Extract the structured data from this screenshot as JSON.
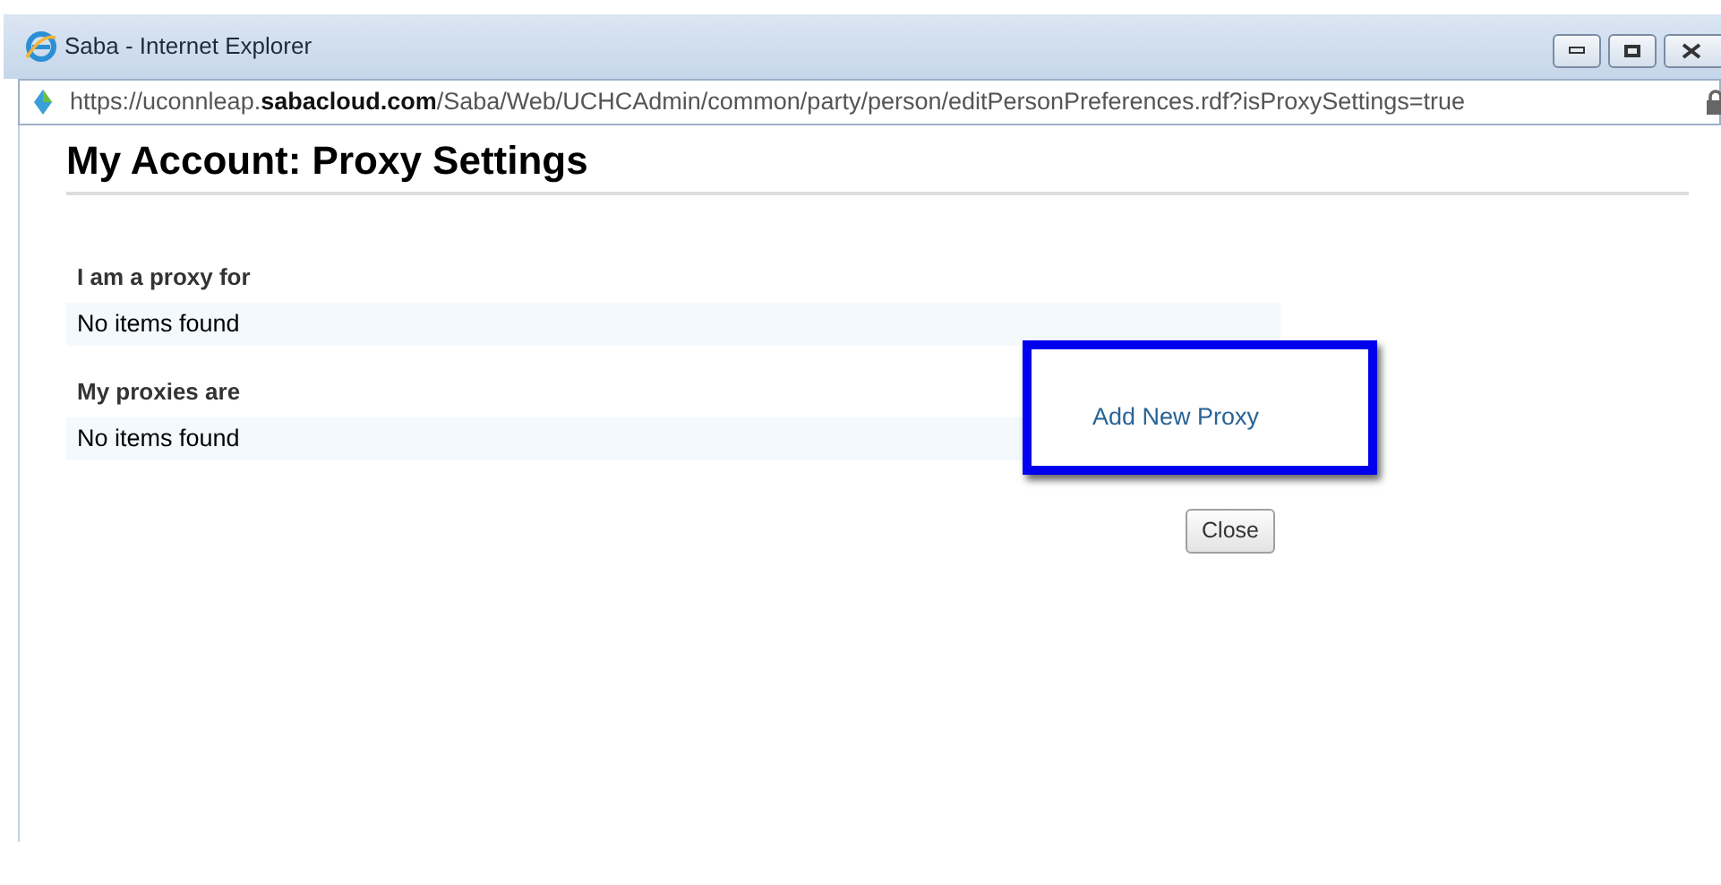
{
  "window": {
    "title": "Saba - Internet Explorer"
  },
  "address_bar": {
    "url": "https://uconnleap.**sabacloud.com**/Saba/Web/UCHCAdmin/common/party/person/editPersonPreferences.rdf?isProxySettings=true"
  },
  "page": {
    "title": "My Account: Proxy Settings",
    "sections": [
      {
        "heading": "I am a proxy for",
        "empty_text": "No items found"
      },
      {
        "heading": "My proxies are",
        "empty_text": "No items found"
      }
    ],
    "add_link": {
      "label": "Add New Proxy",
      "highlighted": true
    },
    "close_button": {
      "label": "Close"
    }
  }
}
